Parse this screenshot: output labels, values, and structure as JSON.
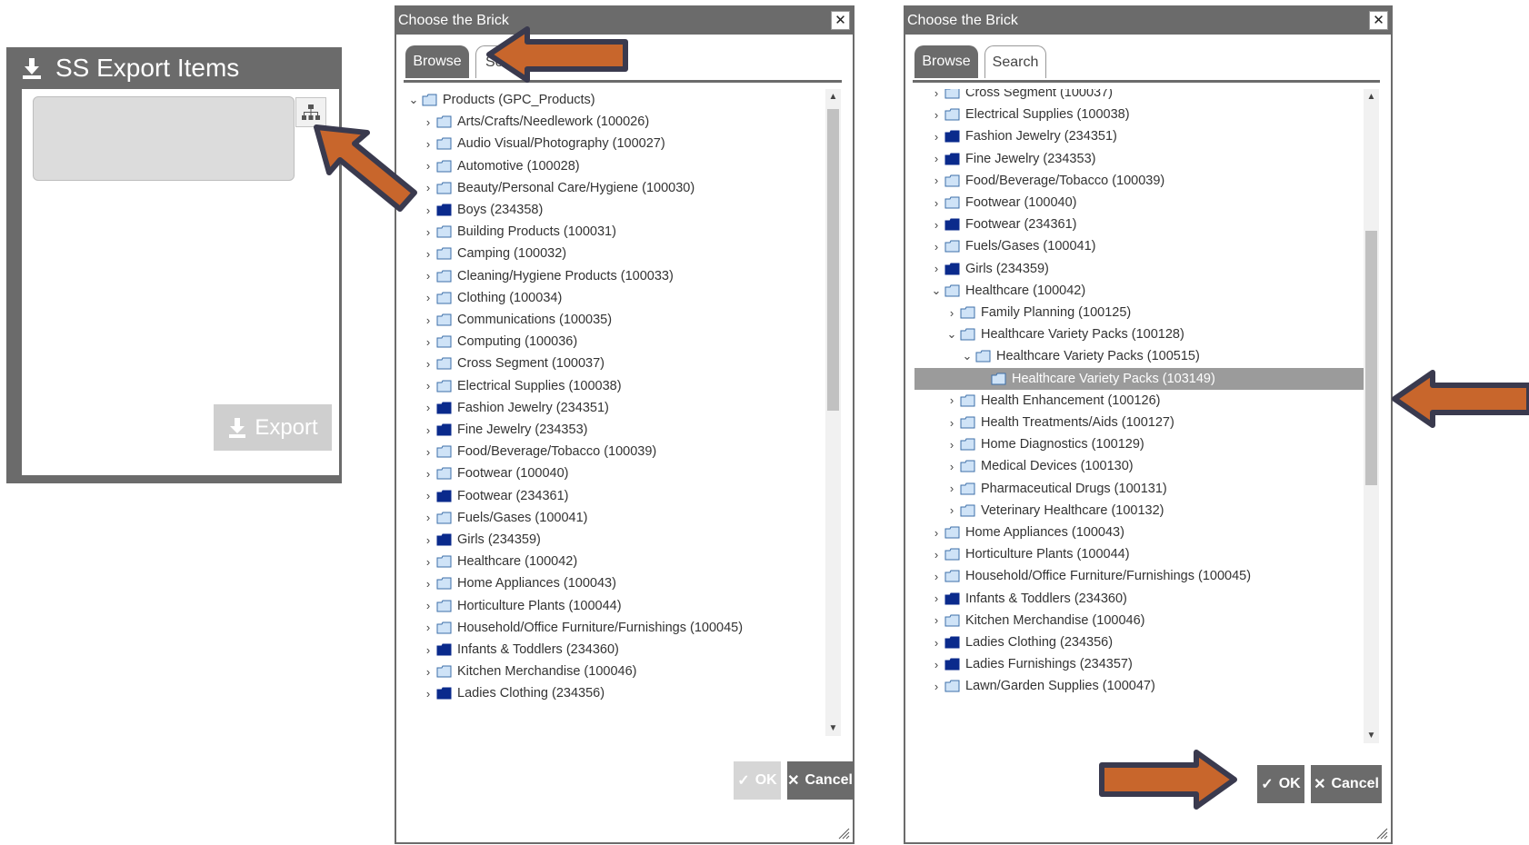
{
  "export_panel": {
    "title": "SS Export Items",
    "export_label": "Export"
  },
  "dialog1": {
    "title": "Choose the Brick",
    "tabs": [
      "Browse",
      "Search"
    ],
    "tab2_visible": "Se",
    "ok_label": "OK",
    "cancel_label": "Cancel",
    "rows": [
      {
        "label": "Products (GPC_Products)",
        "indent": 0,
        "chev": "v",
        "folder": "light"
      },
      {
        "label": "Arts/Crafts/Needlework (100026)",
        "indent": 1,
        "chev": ">",
        "folder": "light"
      },
      {
        "label": "Audio Visual/Photography (100027)",
        "indent": 1,
        "chev": ">",
        "folder": "light"
      },
      {
        "label": "Automotive (100028)",
        "indent": 1,
        "chev": ">",
        "folder": "light"
      },
      {
        "label": "Beauty/Personal Care/Hygiene (100030)",
        "indent": 1,
        "chev": ">",
        "folder": "light"
      },
      {
        "label": "Boys (234358)",
        "indent": 1,
        "chev": ">",
        "folder": "dark"
      },
      {
        "label": "Building Products (100031)",
        "indent": 1,
        "chev": ">",
        "folder": "light"
      },
      {
        "label": "Camping (100032)",
        "indent": 1,
        "chev": ">",
        "folder": "light"
      },
      {
        "label": "Cleaning/Hygiene Products (100033)",
        "indent": 1,
        "chev": ">",
        "folder": "light"
      },
      {
        "label": "Clothing (100034)",
        "indent": 1,
        "chev": ">",
        "folder": "light"
      },
      {
        "label": "Communications (100035)",
        "indent": 1,
        "chev": ">",
        "folder": "light"
      },
      {
        "label": "Computing (100036)",
        "indent": 1,
        "chev": ">",
        "folder": "light"
      },
      {
        "label": "Cross Segment (100037)",
        "indent": 1,
        "chev": ">",
        "folder": "light"
      },
      {
        "label": "Electrical Supplies (100038)",
        "indent": 1,
        "chev": ">",
        "folder": "light"
      },
      {
        "label": "Fashion Jewelry (234351)",
        "indent": 1,
        "chev": ">",
        "folder": "dark"
      },
      {
        "label": "Fine Jewelry (234353)",
        "indent": 1,
        "chev": ">",
        "folder": "dark"
      },
      {
        "label": "Food/Beverage/Tobacco (100039)",
        "indent": 1,
        "chev": ">",
        "folder": "light"
      },
      {
        "label": "Footwear (100040)",
        "indent": 1,
        "chev": ">",
        "folder": "light"
      },
      {
        "label": "Footwear (234361)",
        "indent": 1,
        "chev": ">",
        "folder": "dark"
      },
      {
        "label": "Fuels/Gases (100041)",
        "indent": 1,
        "chev": ">",
        "folder": "light"
      },
      {
        "label": "Girls (234359)",
        "indent": 1,
        "chev": ">",
        "folder": "dark"
      },
      {
        "label": "Healthcare (100042)",
        "indent": 1,
        "chev": ">",
        "folder": "light"
      },
      {
        "label": "Home Appliances (100043)",
        "indent": 1,
        "chev": ">",
        "folder": "light"
      },
      {
        "label": "Horticulture Plants (100044)",
        "indent": 1,
        "chev": ">",
        "folder": "light"
      },
      {
        "label": "Household/Office Furniture/Furnishings (100045)",
        "indent": 1,
        "chev": ">",
        "folder": "light"
      },
      {
        "label": "Infants & Toddlers (234360)",
        "indent": 1,
        "chev": ">",
        "folder": "dark"
      },
      {
        "label": "Kitchen Merchandise (100046)",
        "indent": 1,
        "chev": ">",
        "folder": "light"
      },
      {
        "label": "Ladies Clothing (234356)",
        "indent": 1,
        "chev": ">",
        "folder": "dark"
      }
    ]
  },
  "dialog2": {
    "title": "Choose the Brick",
    "tabs": [
      "Browse",
      "Search"
    ],
    "ok_label": "OK",
    "cancel_label": "Cancel",
    "rows": [
      {
        "label": "Cross Segment (100037)",
        "indent": 1,
        "chev": ">",
        "folder": "light"
      },
      {
        "label": "Electrical Supplies (100038)",
        "indent": 1,
        "chev": ">",
        "folder": "light"
      },
      {
        "label": "Fashion Jewelry (234351)",
        "indent": 1,
        "chev": ">",
        "folder": "dark"
      },
      {
        "label": "Fine Jewelry (234353)",
        "indent": 1,
        "chev": ">",
        "folder": "dark"
      },
      {
        "label": "Food/Beverage/Tobacco (100039)",
        "indent": 1,
        "chev": ">",
        "folder": "light"
      },
      {
        "label": "Footwear (100040)",
        "indent": 1,
        "chev": ">",
        "folder": "light"
      },
      {
        "label": "Footwear (234361)",
        "indent": 1,
        "chev": ">",
        "folder": "dark"
      },
      {
        "label": "Fuels/Gases (100041)",
        "indent": 1,
        "chev": ">",
        "folder": "light"
      },
      {
        "label": "Girls (234359)",
        "indent": 1,
        "chev": ">",
        "folder": "dark"
      },
      {
        "label": "Healthcare (100042)",
        "indent": 1,
        "chev": "v",
        "folder": "light"
      },
      {
        "label": "Family Planning (100125)",
        "indent": 2,
        "chev": ">",
        "folder": "light"
      },
      {
        "label": "Healthcare Variety Packs (100128)",
        "indent": 2,
        "chev": "v",
        "folder": "light"
      },
      {
        "label": "Healthcare Variety Packs (100515)",
        "indent": 3,
        "chev": "v",
        "folder": "light"
      },
      {
        "label": "Healthcare Variety Packs (103149)",
        "indent": 4,
        "chev": "",
        "folder": "light",
        "selected": true
      },
      {
        "label": "Health Enhancement (100126)",
        "indent": 2,
        "chev": ">",
        "folder": "light"
      },
      {
        "label": "Health Treatments/Aids (100127)",
        "indent": 2,
        "chev": ">",
        "folder": "light"
      },
      {
        "label": "Home Diagnostics (100129)",
        "indent": 2,
        "chev": ">",
        "folder": "light"
      },
      {
        "label": "Medical Devices (100130)",
        "indent": 2,
        "chev": ">",
        "folder": "light"
      },
      {
        "label": "Pharmaceutical Drugs (100131)",
        "indent": 2,
        "chev": ">",
        "folder": "light"
      },
      {
        "label": "Veterinary Healthcare (100132)",
        "indent": 2,
        "chev": ">",
        "folder": "light"
      },
      {
        "label": "Home Appliances (100043)",
        "indent": 1,
        "chev": ">",
        "folder": "light"
      },
      {
        "label": "Horticulture Plants (100044)",
        "indent": 1,
        "chev": ">",
        "folder": "light"
      },
      {
        "label": "Household/Office Furniture/Furnishings (100045)",
        "indent": 1,
        "chev": ">",
        "folder": "light"
      },
      {
        "label": "Infants & Toddlers (234360)",
        "indent": 1,
        "chev": ">",
        "folder": "dark"
      },
      {
        "label": "Kitchen Merchandise (100046)",
        "indent": 1,
        "chev": ">",
        "folder": "light"
      },
      {
        "label": "Ladies Clothing (234356)",
        "indent": 1,
        "chev": ">",
        "folder": "dark"
      },
      {
        "label": "Ladies Furnishings (234357)",
        "indent": 1,
        "chev": ">",
        "folder": "dark"
      },
      {
        "label": "Lawn/Garden Supplies (100047)",
        "indent": 1,
        "chev": ">",
        "folder": "light"
      }
    ]
  },
  "colors": {
    "annotation_arrow": "#c8662c",
    "annotation_outline": "#3a3a4e",
    "panel_gray": "#6b6b6b",
    "folder_dark": "#0a2a8c",
    "folder_light": "#cfe3f7"
  }
}
